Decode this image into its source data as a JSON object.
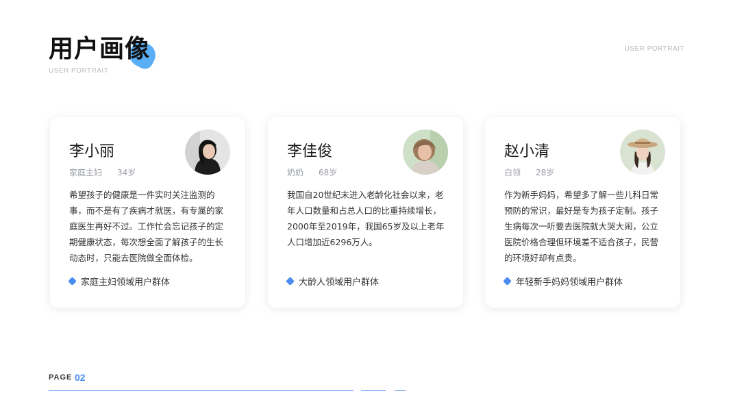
{
  "header": {
    "title": "用户画像",
    "subtitle": "USER PORTRAIT",
    "corner_label": "USER PORTRAIT",
    "accent_color": "#5aaef5"
  },
  "cards": [
    {
      "name": "李小丽",
      "role": "家庭主妇",
      "age": "34岁",
      "avatar": "woman-short-hair-avatar",
      "description": "希望孩子的健康是一件实时关注监测的事，而不是有了疾病才就医，有专属的家庭医生再好不过。工作忙会忘记孩子的定期健康状态，每次想全面了解孩子的生长动态时，只能去医院做全面体检。",
      "tag": "家庭主妇领域用户群体"
    },
    {
      "name": "李佳俊",
      "role": "奶奶",
      "age": "68岁",
      "avatar": "elderly-woman-avatar",
      "description": "我国自20世纪末进入老龄化社会以来，老年人口数量和占总人口的比重持续增长，2000年至2019年，我国65岁及以上老年人口增加近6296万人。",
      "tag": "大龄人领域用户群体"
    },
    {
      "name": "赵小清",
      "role": "白领",
      "age": "28岁",
      "avatar": "young-woman-hat-avatar",
      "description": "作为新手妈妈，希望多了解一些儿科日常预防的常识，最好是专为孩子定制。孩子生病每次一听要去医院就大哭大闹，公立医院价格合理但环境差不适合孩子，民营的环境好却有点贵。",
      "tag": "年轻新手妈妈领域用户群体"
    }
  ],
  "footer": {
    "page_label": "PAGE",
    "page_number": "02",
    "accent_color": "#4b8cf0"
  }
}
